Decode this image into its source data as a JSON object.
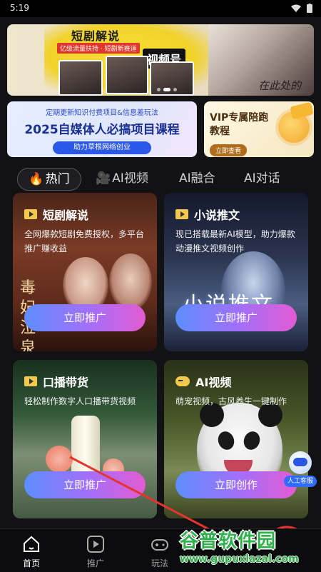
{
  "status_bar": {
    "time": "5:19"
  },
  "banner": {
    "headline": "短剧解说",
    "badge": "视频号",
    "tag": "亿级流量扶持 · 短剧新赛道",
    "poster_text": "在此处的"
  },
  "course_card": {
    "subtitle": "定期更新知识付费项目&信息差玩法",
    "title": "2025自媒体人必搞项目课程",
    "footer": "助力草根网络创业"
  },
  "vip_card": {
    "title": "VIP专属陪跑教程",
    "button": "立即查看"
  },
  "tabs": [
    {
      "label": "热门",
      "icon": "fire-icon"
    },
    {
      "label": "AI视频",
      "icon": "camera-icon"
    },
    {
      "label": "AI融合"
    },
    {
      "label": "AI对话"
    }
  ],
  "cards": [
    {
      "title": "短剧解说",
      "desc": "全网爆款短剧免费授权，多平台推广赚收益",
      "button": "立即推广",
      "art_text": "毒妃泣泉"
    },
    {
      "title": "小说推文",
      "desc": "现已搭载最新AI模型，助力爆款动漫推文视频创作",
      "button": "立即推广",
      "art_text": "小说推文"
    },
    {
      "title": "口播带货",
      "desc": "轻松制作数字人口播带货视频",
      "button": "立即推广"
    },
    {
      "title": "AI视频",
      "desc": "萌宠视频，古风养生一键制作",
      "button": "立即创作"
    }
  ],
  "customer_service": {
    "label": "人工客服"
  },
  "bottom_nav": [
    {
      "label": "首页",
      "icon": "home-icon"
    },
    {
      "label": "推广",
      "icon": "play-icon"
    },
    {
      "label": "玩法",
      "icon": "gamepad-icon"
    }
  ],
  "watermark": {
    "brand": "谷普软件园",
    "url": "www.gupuxlazal.com"
  },
  "colors": {
    "accent_gradient_start": "#5d8dff",
    "accent_gradient_end": "#e35bd2",
    "background": "#121214"
  }
}
